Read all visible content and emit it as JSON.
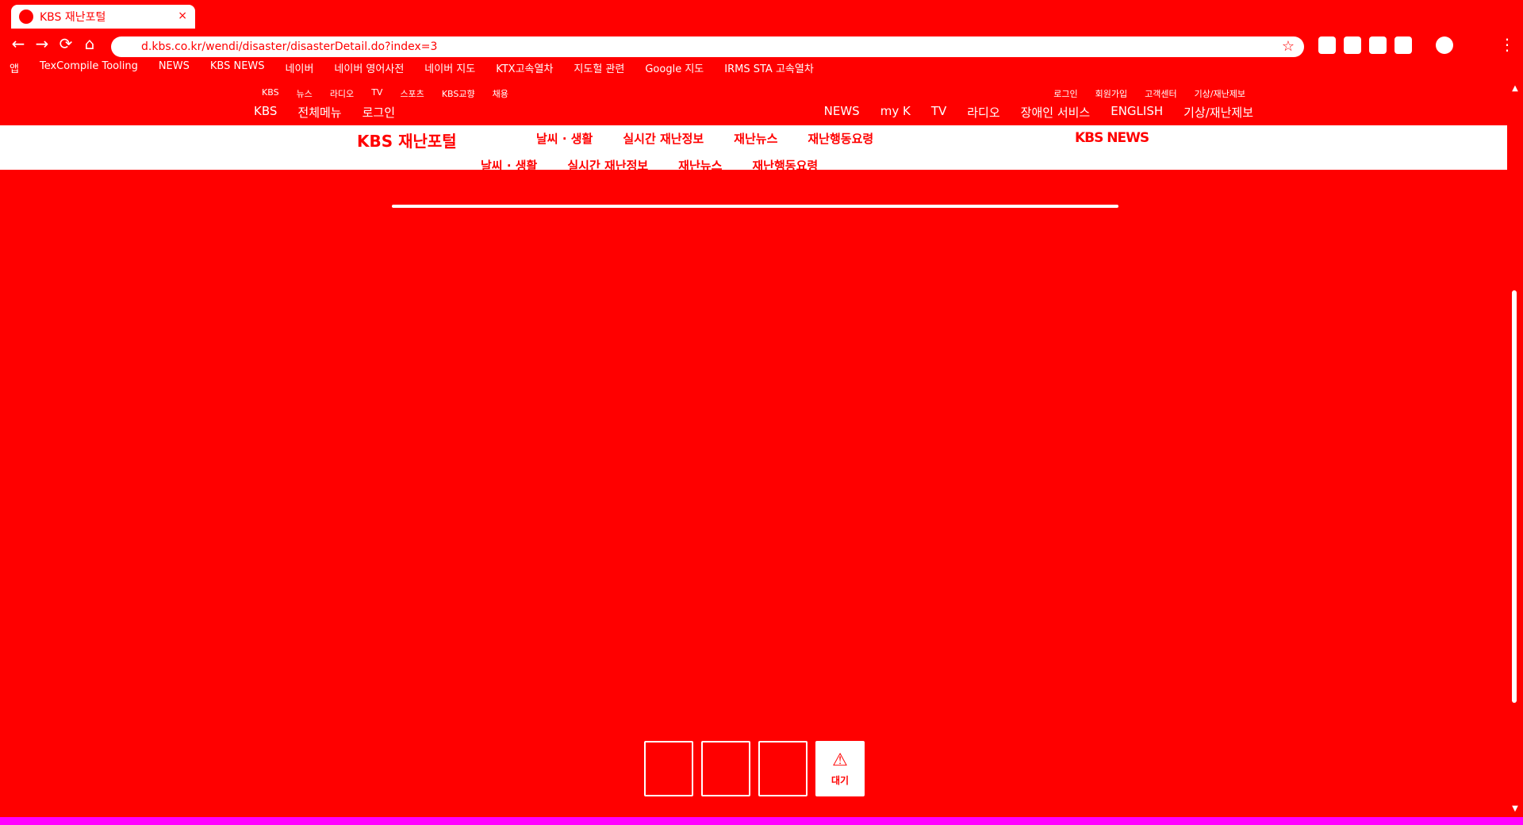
{
  "browser": {
    "tab_title": "KBS 재난포털",
    "tab_close": "×",
    "url": "d.kbs.co.kr/wendi/disaster/disasterDetail.do?index=3",
    "back": "←",
    "forward": "→",
    "reload": "⟳",
    "home": "⌂",
    "star": "☆",
    "menu": "⋮",
    "bookmarks": [
      "앱",
      "TexCompile Tooling",
      "NEWS",
      "KBS NEWS",
      "네이버",
      "네이버 영어사전",
      "네이버 지도",
      "KTX고속열차",
      "지도헐 관련",
      "Google 지도",
      "IRMS STA 고속열차"
    ]
  },
  "util_bar": {
    "left": [
      "KBS",
      "뉴스",
      "라디오",
      "TV",
      "스포츠",
      "KBS교향",
      "채용"
    ],
    "right": [
      "로그인",
      "회원가입",
      "고객센터",
      "기상/재난제보"
    ]
  },
  "global_nav": {
    "left": [
      "KBS",
      "전체메뉴",
      "로그인"
    ],
    "right": [
      "NEWS",
      "my K",
      "TV",
      "라디오",
      "장애인 서비스",
      "ENGLISH",
      "기상/재난제보"
    ]
  },
  "header": {
    "portal_name": "KBS 재난포털",
    "menu": [
      "날씨 · 생활",
      "실시간 재난정보",
      "재난뉴스",
      "재난행동요령"
    ],
    "kbs_news": "KBS NEWS"
  },
  "thumbs": {
    "active_label": "대기",
    "active_icon": "⚠"
  },
  "colors": {
    "primary": "#ff0000",
    "foreground": "#ffffff",
    "bottom_strip": "#ff00ff"
  }
}
